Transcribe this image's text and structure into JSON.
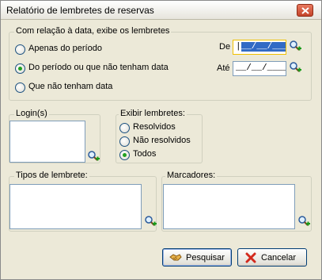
{
  "window": {
    "title": "Relatório de lembretes de reservas"
  },
  "period_group": {
    "label": "Com relação à data, exibe os lembretes",
    "options": [
      {
        "label": "Apenas do período",
        "checked": false
      },
      {
        "label": "Do período ou que não tenham data",
        "checked": true
      },
      {
        "label": "Que não tenham data",
        "checked": false
      }
    ],
    "de_label": "De",
    "ate_label": "Até",
    "de_value": "__/__/____",
    "ate_value": "__/__/____"
  },
  "login_group": {
    "label": "Login(s)"
  },
  "exibir_group": {
    "label": "Exibir lembretes:",
    "options": [
      {
        "label": "Resolvidos",
        "checked": false
      },
      {
        "label": "Não resolvidos",
        "checked": false
      },
      {
        "label": "Todos",
        "checked": true
      }
    ]
  },
  "tipos_group": {
    "label": "Tipos de lembrete:"
  },
  "marcadores_group": {
    "label": "Marcadores:"
  },
  "buttons": {
    "search_label": "Pesquisar",
    "cancel_label": "Cancelar"
  },
  "icons": {
    "lookup": "magnifier-plus-icon",
    "search_button": "handshake-icon",
    "cancel_button": "red-x-icon",
    "close": "close-x-icon"
  },
  "colors": {
    "radio_checked": "#21a121",
    "focus_border": "#f0c000",
    "selection": "#316ac5",
    "cancel_x": "#d32a1e"
  }
}
